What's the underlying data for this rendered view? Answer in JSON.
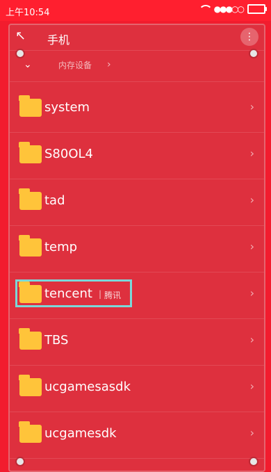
{
  "status": {
    "time": "上午10:54",
    "signal": "●●●○○"
  },
  "header": {
    "title": "手机",
    "back_icon": "back-icon",
    "menu_icon": "more-icon"
  },
  "breadcrumb": {
    "label": "内存设备"
  },
  "folders": [
    {
      "name": "system"
    },
    {
      "name": "S80OL4"
    },
    {
      "name": "tad"
    },
    {
      "name": "temp"
    },
    {
      "name": "tencent",
      "tag": "腾讯",
      "selected": true
    },
    {
      "name": "TBS"
    },
    {
      "name": "ucgamesasdk"
    },
    {
      "name": "ucgamesdk"
    }
  ],
  "colors": {
    "accent": "#ff1f2f",
    "folder": "#ffc43a",
    "selection": "#7bd8d9"
  }
}
